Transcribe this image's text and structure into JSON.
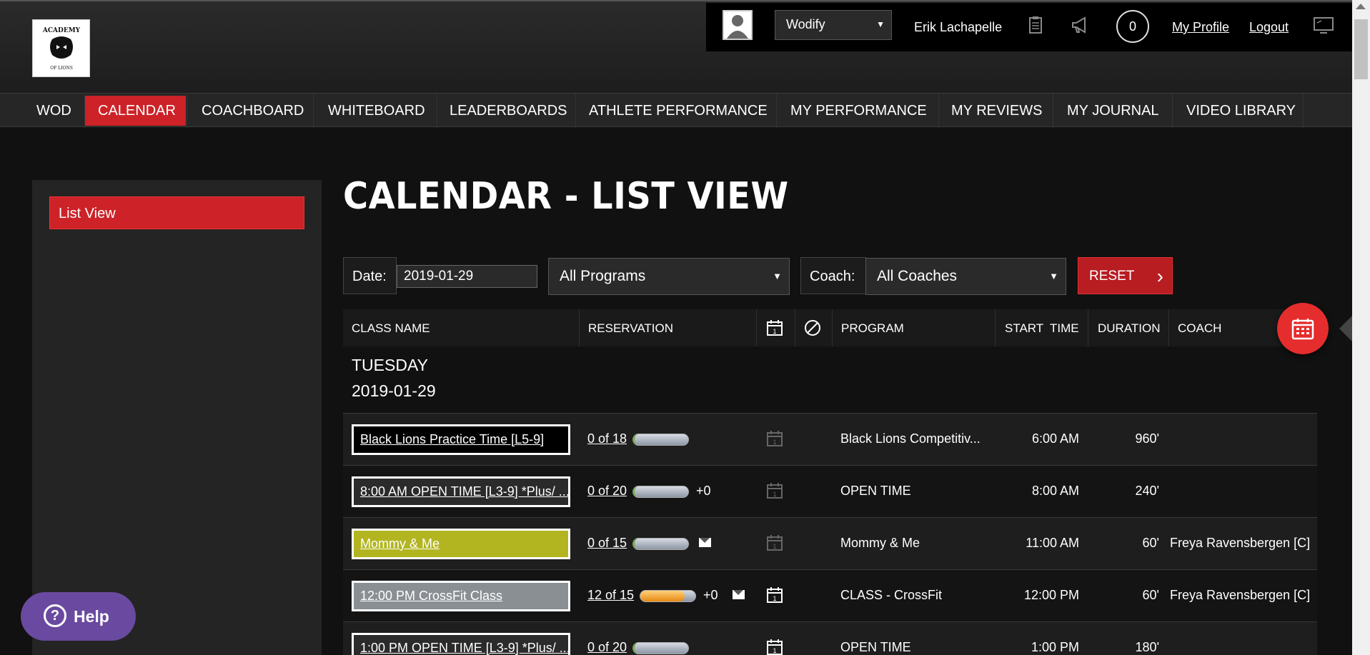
{
  "header": {
    "gym_select": "Wodify",
    "user_name": "Erik Lachapelle",
    "notification_count": "0",
    "my_profile": "My Profile",
    "logout": "Logout"
  },
  "nav": {
    "items": [
      "WOD",
      "CALENDAR",
      "COACHBOARD",
      "WHITEBOARD",
      "LEADERBOARDS",
      "ATHLETE PERFORMANCE",
      "MY PERFORMANCE",
      "MY REVIEWS",
      "MY JOURNAL",
      "VIDEO LIBRARY"
    ],
    "active": "CALENDAR"
  },
  "sidebar": {
    "items": [
      "List View"
    ]
  },
  "page": {
    "title": "CALENDAR - LIST VIEW"
  },
  "filters": {
    "date_label": "Date:",
    "date_value": "2019-01-29",
    "program": "All Programs",
    "coach_label": "Coach:",
    "coach": "All Coaches",
    "reset": "RESET"
  },
  "table": {
    "headers": [
      "CLASS NAME",
      "RESERVATION",
      "PROGRAM",
      "START  TIME",
      "DURATION",
      "COACH"
    ],
    "day_name": "TUESDAY",
    "day_date": "2019-01-29",
    "rows": [
      {
        "class_name": "Black Lions Practice Time [L5-9]",
        "reservation": "0 of 18",
        "fill": 0,
        "extra": "",
        "mail": false,
        "program": "Black Lions Competitiv...",
        "start": "6:00 AM",
        "duration": "960'",
        "coach": "",
        "name_bg": "#000000",
        "name_fg": "#ffffff",
        "cal_active": false
      },
      {
        "class_name": "8:00 AM OPEN TIME [L3-9] *Plus/ ...",
        "reservation": "0 of 20",
        "fill": 0,
        "extra": "+0",
        "mail": false,
        "program": "OPEN TIME",
        "start": "8:00 AM",
        "duration": "240'",
        "coach": "",
        "name_bg": "#2b2b2b",
        "name_fg": "#ffffff",
        "cal_active": false
      },
      {
        "class_name": "Mommy & Me",
        "reservation": "0 of 15",
        "fill": 0,
        "extra": "",
        "mail": true,
        "program": "Mommy & Me",
        "start": "11:00 AM",
        "duration": "60'",
        "coach": "Freya Ravensbergen [C]",
        "name_bg": "#b2b520",
        "name_fg": "#ffffff",
        "cal_active": false
      },
      {
        "class_name": "12:00 PM CrossFit Class",
        "reservation": "12 of 15",
        "fill": 0.8,
        "extra": "+0",
        "mail": true,
        "program": "CLASS - CrossFit",
        "start": "12:00 PM",
        "duration": "60'",
        "coach": "Freya Ravensbergen [C]",
        "name_bg": "#8a8f94",
        "name_fg": "#ffffff",
        "cal_active": true
      },
      {
        "class_name": "1:00 PM OPEN TIME [L3-9] *Plus/ ...",
        "reservation": "0 of 20",
        "fill": 0,
        "extra": "",
        "mail": false,
        "program": "OPEN TIME",
        "start": "1:00 PM",
        "duration": "180'",
        "coach": "",
        "name_bg": "#2b2b2b",
        "name_fg": "#ffffff",
        "cal_active": true
      }
    ]
  },
  "help": {
    "label": "Help"
  },
  "colors": {
    "accent": "#cc2228",
    "help": "#6a4aa0",
    "fab": "#e52d2d"
  },
  "icons": [
    "avatar-icon",
    "clipboard-icon",
    "megaphone-icon",
    "monitor-icon",
    "calendar-icon",
    "cancel-icon",
    "mail-icon",
    "help-icon"
  ]
}
